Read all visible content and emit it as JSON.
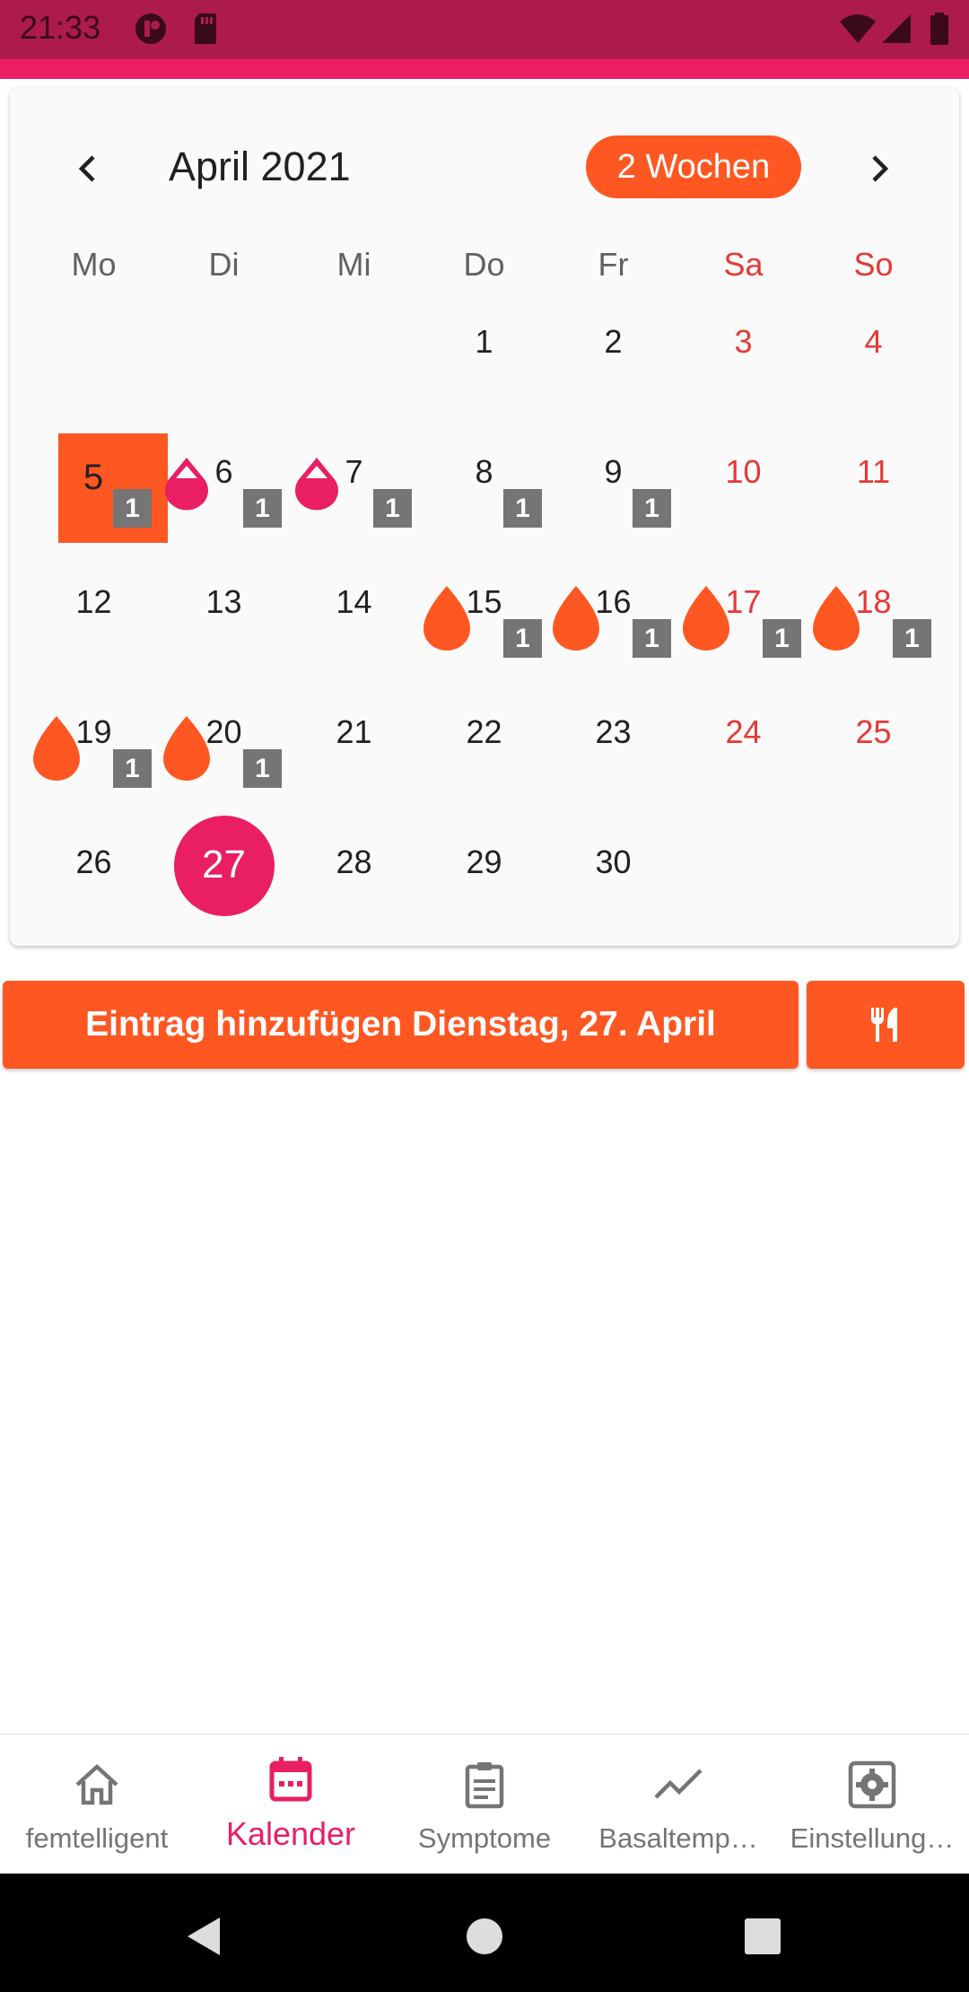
{
  "status_bar": {
    "time": "21:33"
  },
  "calendar": {
    "month_title": "April 2021",
    "format_button": "2 Wochen",
    "weekdays": [
      "Mo",
      "Di",
      "Mi",
      "Do",
      "Fr",
      "Sa",
      "So"
    ],
    "days": [
      {
        "n": "1"
      },
      {
        "n": "2"
      },
      {
        "n": "3"
      },
      {
        "n": "4"
      },
      {
        "n": "5",
        "marker": "1",
        "highlight": "selected-range"
      },
      {
        "n": "6",
        "marker": "1",
        "drop": "outline"
      },
      {
        "n": "7",
        "marker": "1",
        "drop": "outline"
      },
      {
        "n": "8",
        "marker": "1"
      },
      {
        "n": "9",
        "marker": "1"
      },
      {
        "n": "10"
      },
      {
        "n": "11"
      },
      {
        "n": "12"
      },
      {
        "n": "13"
      },
      {
        "n": "14"
      },
      {
        "n": "15",
        "marker": "1",
        "drop": "filled"
      },
      {
        "n": "16",
        "marker": "1",
        "drop": "filled"
      },
      {
        "n": "17",
        "marker": "1",
        "drop": "filled"
      },
      {
        "n": "18",
        "marker": "1",
        "drop": "filled"
      },
      {
        "n": "19",
        "marker": "1",
        "drop": "filled"
      },
      {
        "n": "20",
        "marker": "1",
        "drop": "filled"
      },
      {
        "n": "21"
      },
      {
        "n": "22"
      },
      {
        "n": "23"
      },
      {
        "n": "24"
      },
      {
        "n": "25"
      },
      {
        "n": "26"
      },
      {
        "n": "27",
        "today": true
      },
      {
        "n": "28"
      },
      {
        "n": "29"
      },
      {
        "n": "30"
      }
    ]
  },
  "actions": {
    "add_entry": "Eintrag hinzufügen Dienstag, 27. April",
    "food_icon": "fork-knife-icon"
  },
  "bottom_nav": {
    "tabs": [
      {
        "label": "femtelligent",
        "icon": "home-icon"
      },
      {
        "label": "Kalender",
        "icon": "calendar-icon",
        "active": true
      },
      {
        "label": "Symptome",
        "icon": "clipboard-icon"
      },
      {
        "label": "Basaltemp…",
        "icon": "trend-line-icon"
      },
      {
        "label": "Einstellung…",
        "icon": "settings-icon"
      }
    ]
  },
  "colors": {
    "status_bar": "#ad1a4e",
    "primary": "#e91e63",
    "accent": "#ff5722",
    "weekend_text": "#e53935",
    "marker_badge": "#757575"
  }
}
